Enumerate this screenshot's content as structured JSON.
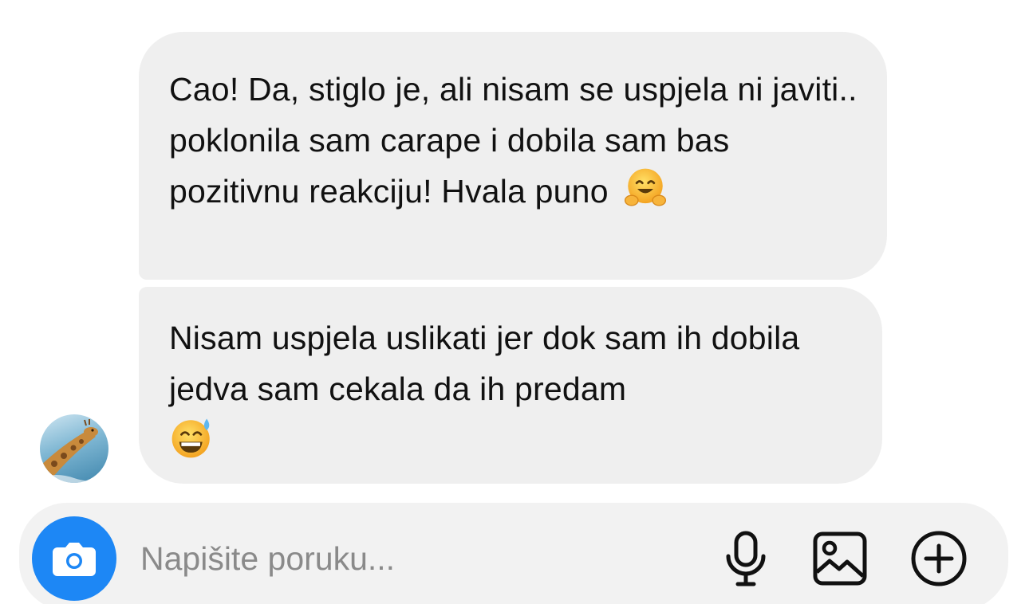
{
  "conversation": {
    "messages": [
      {
        "text": "Cao! Da, stiglo je, ali nisam se uspjela ni javiti.. poklonila sam carape i dobila sam bas pozitivnu reakciju! Hvala puno",
        "emoji": "hugging-face-emoji"
      },
      {
        "text": "Nisam uspjela uslikati jer dok sam ih dobila jedva sam cekala da ih predam",
        "emoji": "grinning-face-with-sweat-emoji"
      }
    ],
    "avatar": "giraffe-avatar"
  },
  "composer": {
    "placeholder": "Napišite poruku...",
    "icons": {
      "camera": "camera-icon",
      "mic": "microphone-icon",
      "gallery": "image-icon",
      "add": "plus-circle-icon"
    },
    "accent_color": "#1d87f5",
    "sent_bubble_border_color": "#3b73d9"
  }
}
